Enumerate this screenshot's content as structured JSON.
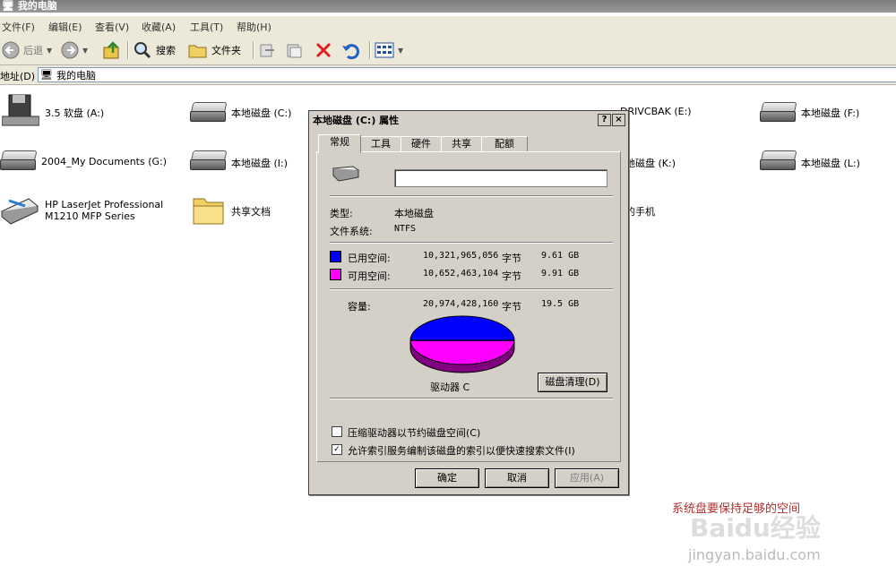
{
  "window": {
    "title": "我的电脑"
  },
  "menu": [
    "文件(F)",
    "编辑(E)",
    "查看(V)",
    "收藏(A)",
    "工具(T)",
    "帮助(H)"
  ],
  "toolbar": {
    "back": "后退",
    "search": "搜索",
    "folders": "文件夹"
  },
  "address": {
    "label": "地址(D)",
    "value": "我的电脑"
  },
  "items": [
    {
      "label": "3.5 软盘 (A:)",
      "icon": "floppy-drive-icon"
    },
    {
      "label": "本地磁盘 (C:)",
      "icon": "hard-drive-icon"
    },
    {
      "label": "DRIVCBAK (E:)",
      "icon": "hard-drive-icon"
    },
    {
      "label": "本地磁盘 (F:)",
      "icon": "hard-drive-icon"
    },
    {
      "label": "2004_My Documents (G:)",
      "icon": "hard-drive-icon"
    },
    {
      "label": "本地磁盘 (I:)",
      "icon": "hard-drive-icon"
    },
    {
      "label": "地磁盘 (K:)",
      "icon": "hard-drive-icon"
    },
    {
      "label": "本地磁盘 (L:)",
      "icon": "hard-drive-icon"
    },
    {
      "label": "HP LaserJet Professional M1210 MFP Series",
      "icon": "scanner-icon"
    },
    {
      "label": "共享文档",
      "icon": "folder-icon"
    },
    {
      "label": "的手机",
      "icon": "phone-icon"
    }
  ],
  "dialog": {
    "title": "本地磁盘 (C:) 属性",
    "tabs": [
      "常规",
      "工具",
      "硬件",
      "共享",
      "配额"
    ],
    "type_label": "类型:",
    "type_value": "本地磁盘",
    "fs_label": "文件系统:",
    "fs_value": "NTFS",
    "used_label": "已用空间:",
    "used_bytes": "10,321,965,056",
    "used_unit": "字节",
    "used_gb": "9.61 GB",
    "free_label": "可用空间:",
    "free_bytes": "10,652,463,104",
    "free_unit": "字节",
    "free_gb": "9.91 GB",
    "cap_label": "容量:",
    "cap_bytes": "20,974,428,160",
    "cap_unit": "字节",
    "cap_gb": "19.5 GB",
    "drive_label": "驱动器 C",
    "cleanup_button": "磁盘清理(D)",
    "compress_label": "压缩驱动器以节约磁盘空间(C)",
    "compress_checked": false,
    "index_label": "允许索引服务编制该磁盘的索引以便快速搜索文件(I)",
    "index_checked": true,
    "ok": "确定",
    "cancel": "取消",
    "apply": "应用(A)",
    "used_fraction": 0.492,
    "colors": {
      "used": "#0000ff",
      "free": "#ff00ff"
    }
  },
  "annotation": "系统盘要保持足够的空间",
  "watermark": {
    "brand": "Baidu经验",
    "url": "jingyan.baidu.com"
  }
}
